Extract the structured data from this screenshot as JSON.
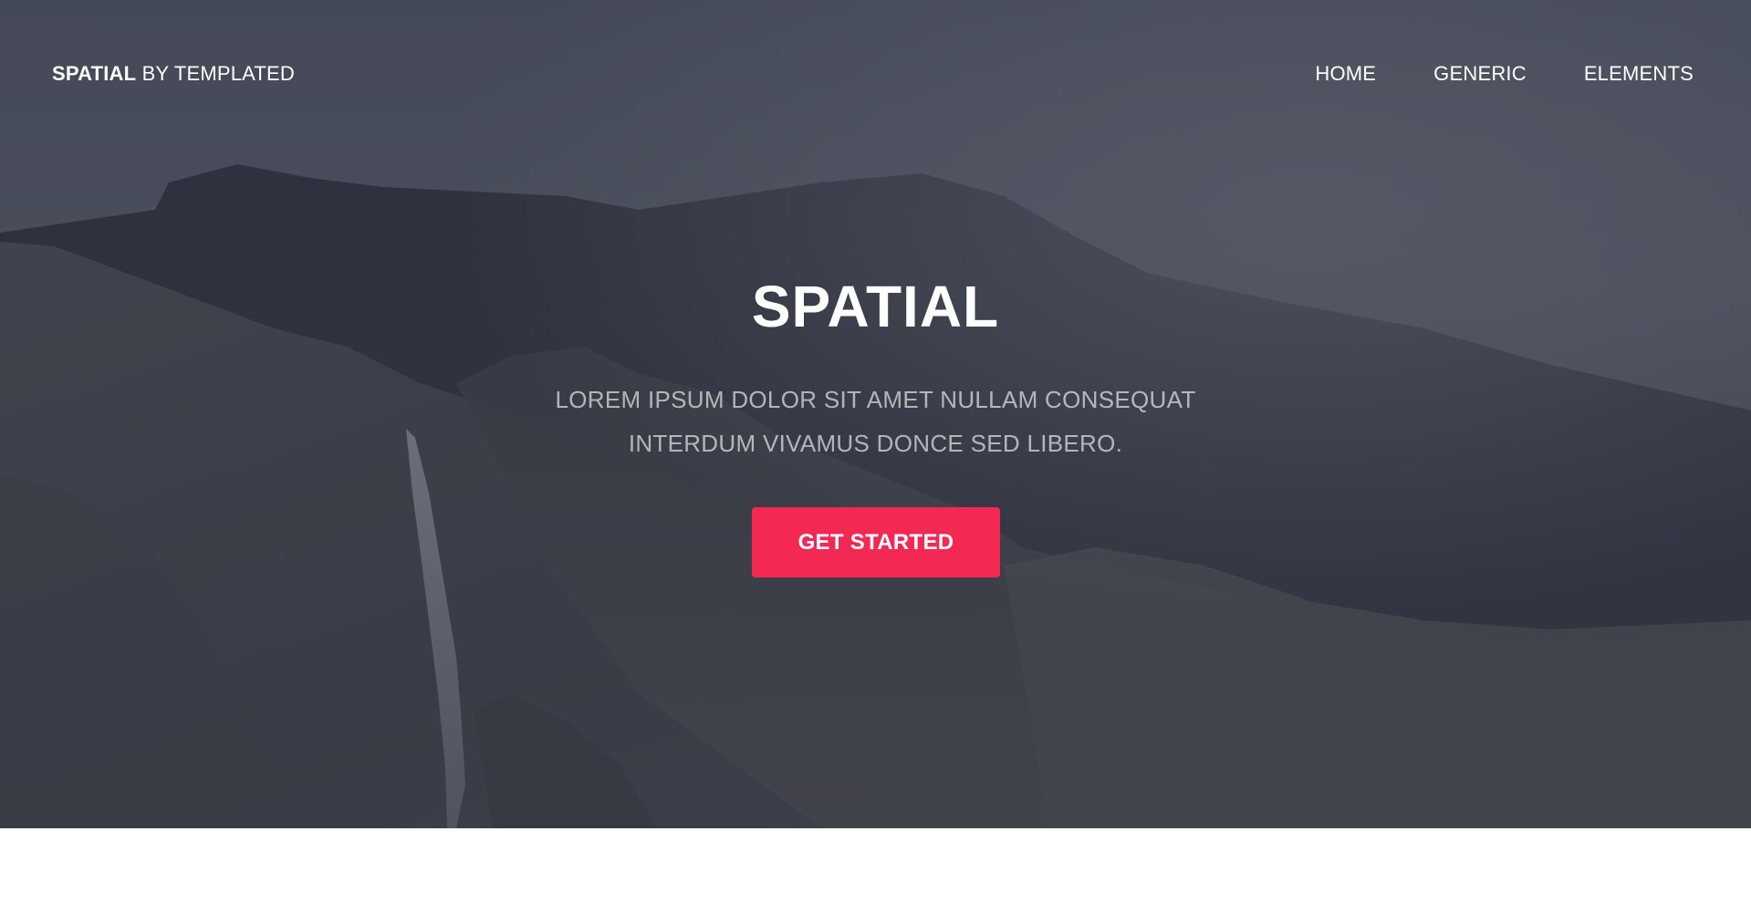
{
  "header": {
    "logo_strong": "SPATIAL",
    "logo_rest": "BY TEMPLATED",
    "nav": [
      {
        "label": "HOME"
      },
      {
        "label": "GENERIC"
      },
      {
        "label": "ELEMENTS"
      }
    ]
  },
  "banner": {
    "title": "SPATIAL",
    "subtitle_line1": "LOREM IPSUM DOLOR SIT AMET NULLAM CONSEQUAT",
    "subtitle_line2": "INTERDUM VIVAMUS DONCE SED LIBERO.",
    "button_label": "GET STARTED"
  },
  "colors": {
    "accent": "#f32853",
    "overlay": "#3b3f4d",
    "text": "#ffffff"
  }
}
